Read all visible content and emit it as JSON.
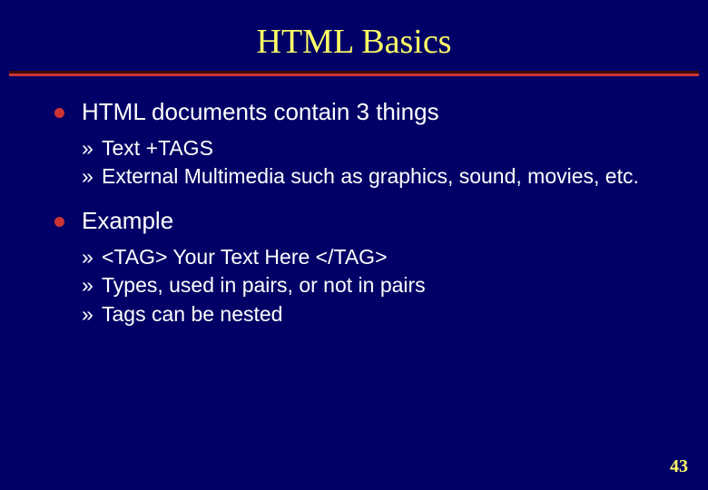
{
  "title": "HTML Basics",
  "bullets": [
    {
      "text": "HTML documents contain 3 things",
      "sub": [
        "Text +TAGS",
        "External Multimedia such as graphics, sound, movies, etc."
      ]
    },
    {
      "text": "Example",
      "sub": [
        "<TAG>  Your Text Here </TAG>",
        "Types, used in pairs, or not in pairs",
        "Tags can be nested"
      ]
    }
  ],
  "sub_bullet_glyph": "»",
  "page_number": "43"
}
